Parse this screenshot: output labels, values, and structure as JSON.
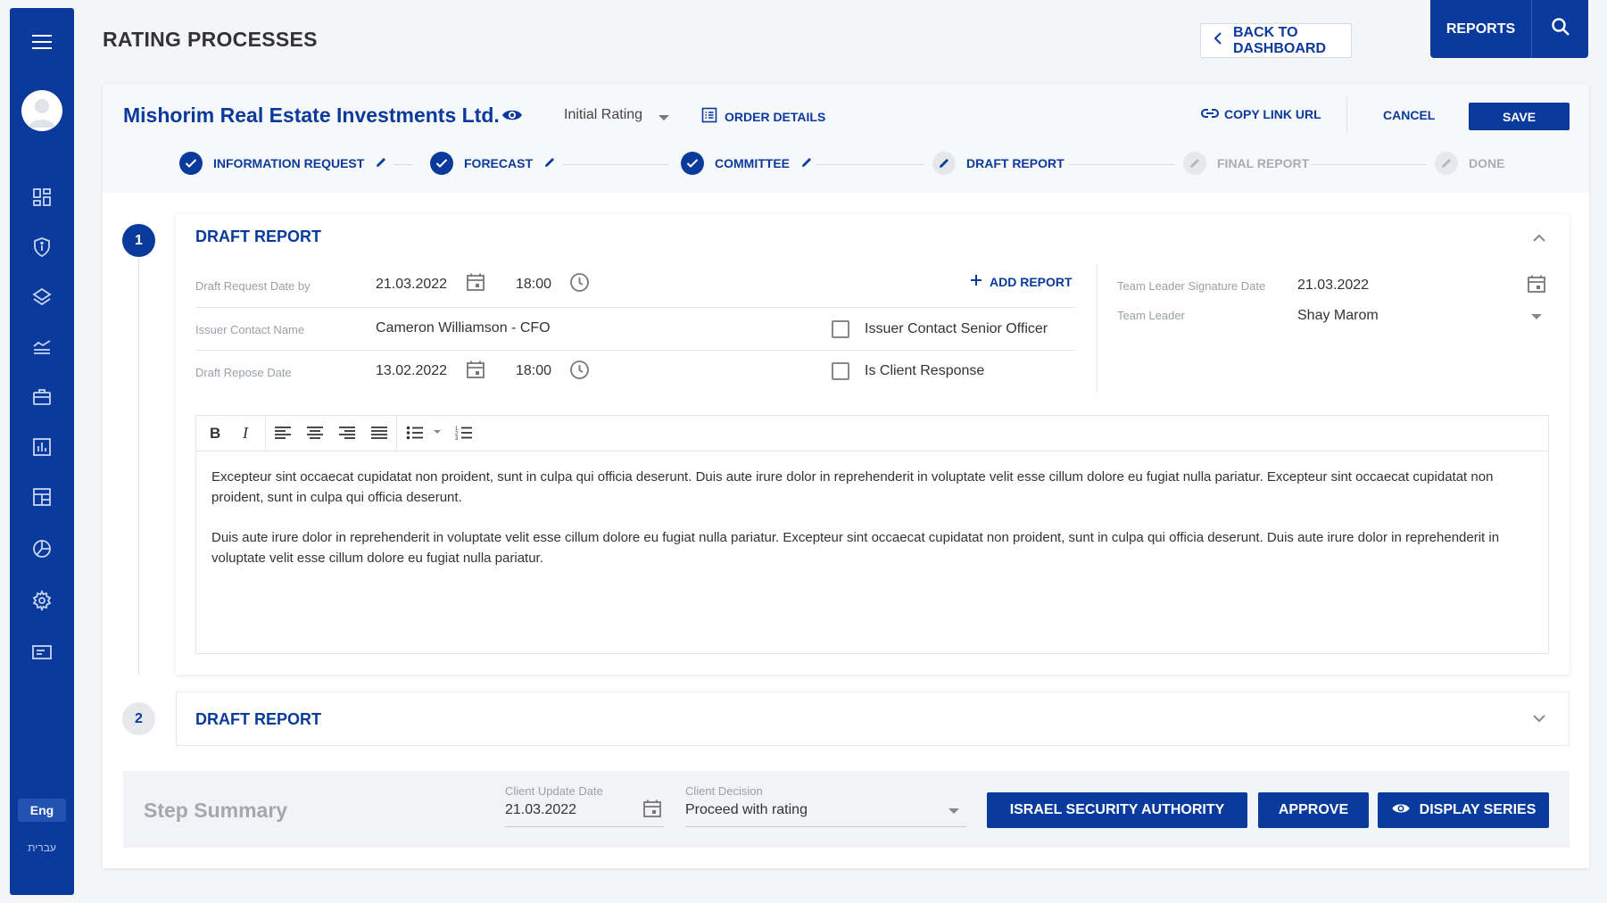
{
  "header": {
    "title": "RATING PROCESSES",
    "back_label": "BACK TO DASHBOARD",
    "reports_label": "REPORTS"
  },
  "sidebar": {
    "lang_label": "Eng",
    "alt_lang_label": "עברית",
    "icons": [
      "dashboard-icon",
      "shield-icon",
      "layers-icon",
      "trend-icon",
      "briefcase-icon",
      "bar-chart-icon",
      "layout-icon",
      "pie-chart-icon",
      "gear-icon",
      "card-icon"
    ]
  },
  "company": {
    "name": "Mishorim Real Estate Investments Ltd.",
    "rating_type": "Initial Rating",
    "order_details_label": "ORDER DETAILS",
    "copy_link_label": "COPY LINK URL",
    "cancel_label": "CANCEL",
    "save_label": "SAVE"
  },
  "stepper": [
    {
      "label": "INFORMATION REQUEST",
      "state": "done"
    },
    {
      "label": "FORECAST",
      "state": "done"
    },
    {
      "label": "COMMITTEE",
      "state": "done"
    },
    {
      "label": "DRAFT REPORT",
      "state": "active"
    },
    {
      "label": "FINAL REPORT",
      "state": "future"
    },
    {
      "label": "DONE",
      "state": "future"
    }
  ],
  "section1": {
    "number": "1",
    "title": "DRAFT REPORT",
    "add_report_label": "ADD REPORT",
    "draft_request_label": "Draft Request Date by",
    "draft_request_date": "21.03.2022",
    "draft_request_time": "18:00",
    "issuer_contact_label": "Issuer Contact Name",
    "issuer_contact_value": "Cameron Williamson - CFO",
    "issuer_senior_label": "Issuer Contact Senior Officer",
    "draft_repose_label": "Draft Repose Date",
    "draft_repose_date": "13.02.2022",
    "draft_repose_time": "18:00",
    "client_response_label": "Is Client Response",
    "team_leader_sig_label": "Team Leader Signature Date",
    "team_leader_sig_date": "21.03.2022",
    "team_leader_label": "Team Leader",
    "team_leader_value": "Shay Marom",
    "editor_paragraphs": [
      "Excepteur sint occaecat cupidatat non proident, sunt in culpa qui officia deserunt. Duis aute irure dolor in reprehenderit in voluptate velit esse cillum dolore eu fugiat nulla pariatur. Excepteur sint occaecat cupidatat non proident, sunt in culpa qui officia deserunt.",
      "Duis aute irure dolor in reprehenderit in voluptate velit esse cillum dolore eu fugiat nulla pariatur. Excepteur sint occaecat cupidatat non proident, sunt in culpa qui officia deserunt. Duis aute irure dolor in reprehenderit in voluptate velit esse cillum dolore eu fugiat nulla pariatur."
    ]
  },
  "section2": {
    "number": "2",
    "title": "DRAFT REPORT"
  },
  "summary": {
    "title": "Step Summary",
    "client_update_label": "Client Update Date",
    "client_update_date": "21.03.2022",
    "client_decision_label": "Client Decision",
    "client_decision_value": "Proceed with rating",
    "isa_label": "ISRAEL SECURITY AUTHORITY",
    "approve_label": "APPROVE",
    "display_series_label": "DISPLAY SERIES"
  },
  "colors": {
    "primary": "#0a3a9c",
    "muted": "#a8adb5"
  }
}
